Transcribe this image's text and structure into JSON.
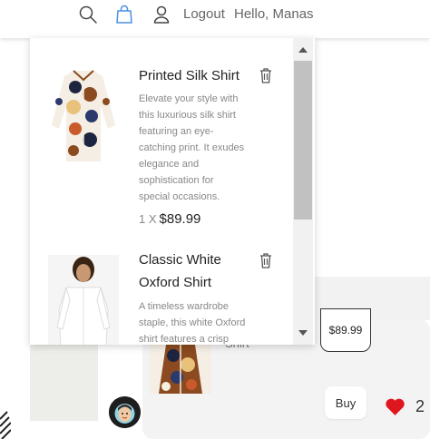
{
  "header": {
    "logout_label": "Logout",
    "greeting": "Hello, Manas",
    "icons": [
      "search-icon",
      "shopping-bag-icon",
      "user-icon"
    ]
  },
  "cart": {
    "items": [
      {
        "title": "Printed Silk Shirt",
        "description_lines": [
          "Elevate your style with",
          "this luxurious silk shirt",
          "featuring an eye-",
          "catching print. It exudes",
          "elegance and",
          "sophistication for",
          "special occasions."
        ],
        "qty_label": "1 X",
        "price": "$89.99"
      },
      {
        "title_lines": [
          "Classic White",
          "Oxford Shirt"
        ],
        "description_lines": [
          "A timeless wardrobe",
          "staple, this white Oxford",
          "shirt features a crisp"
        ]
      }
    ]
  },
  "background": {
    "card_price": "$89.99",
    "shirt_word": "Shirt",
    "buy_label": "Buy",
    "like_count": "2"
  },
  "colors": {
    "accent_blue": "#4a90e2",
    "heart_red": "#e0161e",
    "scrollbar_thumb": "#c1c1c1"
  }
}
